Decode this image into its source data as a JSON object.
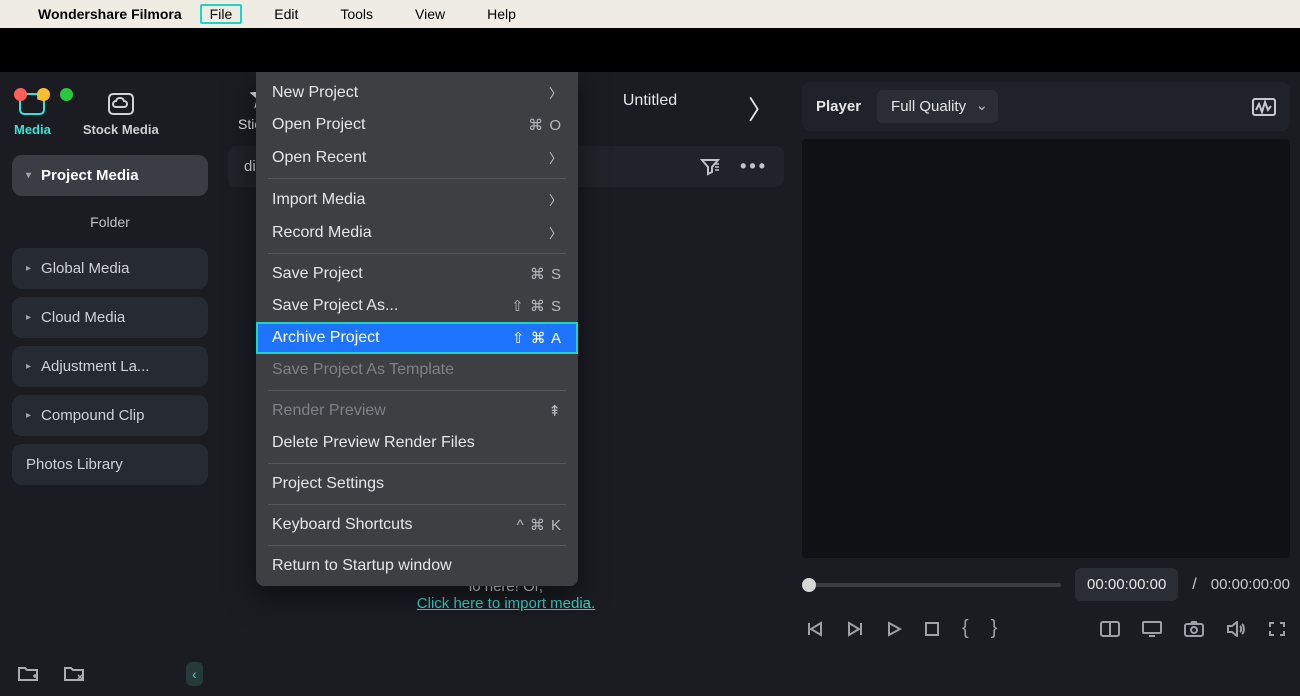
{
  "menubar": {
    "app_name": "Wondershare Filmora",
    "items": [
      "File",
      "Edit",
      "Tools",
      "View",
      "Help"
    ],
    "highlighted_index": 0
  },
  "window_title": "Untitled",
  "left": {
    "tabs": [
      {
        "label": "Media",
        "active": true
      },
      {
        "label": "Stock Media",
        "active": false
      }
    ],
    "project_media": "Project Media",
    "folder": "Folder",
    "items": [
      "Global Media",
      "Cloud Media",
      "Adjustment La...",
      "Compound Clip",
      "Photos Library"
    ]
  },
  "center": {
    "stickers": "Stickers",
    "search_label": "dia",
    "drop_line": "io here! Or,",
    "drop_link": "Click here to import media."
  },
  "player": {
    "label": "Player",
    "quality": "Full Quality",
    "time_current": "00:00:00:00",
    "time_total": "00:00:00:00"
  },
  "file_menu": {
    "items": [
      {
        "label": "New Project",
        "shortcut": "",
        "chevron": true
      },
      {
        "label": "Open Project",
        "shortcut": "⌘ O"
      },
      {
        "label": "Open Recent",
        "shortcut": "",
        "chevron": true
      },
      {
        "sep": true
      },
      {
        "label": "Import Media",
        "shortcut": "",
        "chevron": true
      },
      {
        "label": "Record Media",
        "shortcut": "",
        "chevron": true
      },
      {
        "sep": true
      },
      {
        "label": "Save Project",
        "shortcut": "⌘ S"
      },
      {
        "label": "Save Project As...",
        "shortcut": "⇧ ⌘ S"
      },
      {
        "label": "Archive Project",
        "shortcut": "⇧ ⌘ A",
        "highlighted": true
      },
      {
        "label": "Save Project As Template",
        "disabled": true
      },
      {
        "sep": true
      },
      {
        "label": "Render Preview",
        "shortcut": "⤒",
        "disabled": true
      },
      {
        "label": "Delete Preview Render Files"
      },
      {
        "sep": true
      },
      {
        "label": "Project Settings"
      },
      {
        "sep": true
      },
      {
        "label": "Keyboard Shortcuts",
        "shortcut": "^ ⌘ K"
      },
      {
        "sep": true
      },
      {
        "label": "Return to Startup window"
      }
    ]
  }
}
